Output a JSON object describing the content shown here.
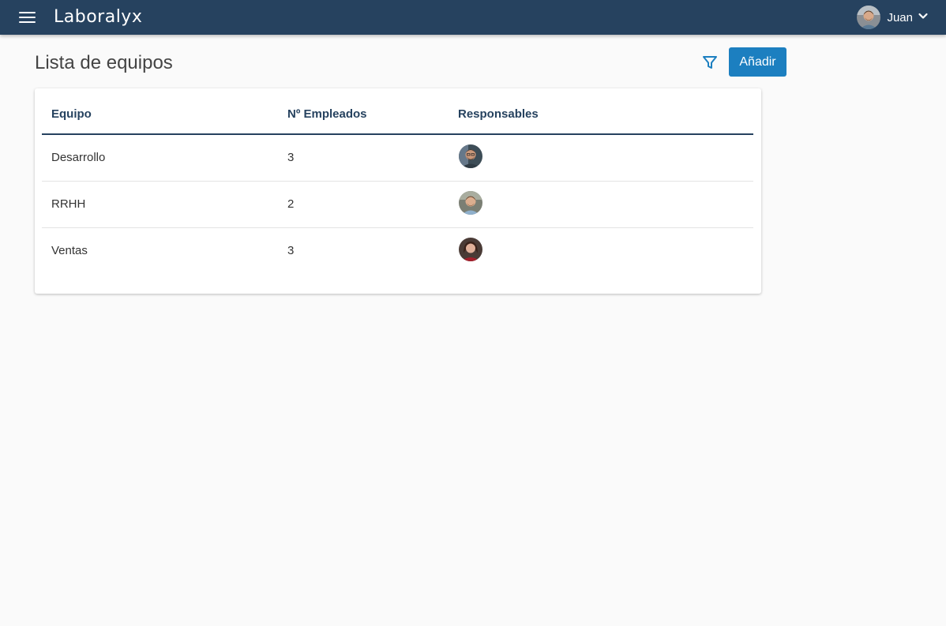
{
  "app": {
    "brand": "Laboralyx",
    "user": {
      "name": "Juan"
    }
  },
  "page": {
    "title": "Lista de equipos",
    "add_label": "Añadir"
  },
  "table": {
    "headers": {
      "team": "Equipo",
      "employees": "Nº Empleados",
      "managers": "Responsables"
    },
    "rows": [
      {
        "team": "Desarrollo",
        "employees": "3"
      },
      {
        "team": "RRHH",
        "employees": "2"
      },
      {
        "team": "Ventas",
        "employees": "3"
      }
    ]
  },
  "colors": {
    "topbar": "#26425f",
    "accent": "#1c7fc0",
    "header_text": "#26425f"
  },
  "icons": {
    "menu": "hamburger-icon",
    "filter": "filter-icon",
    "dropdown": "chevron-down-icon"
  }
}
